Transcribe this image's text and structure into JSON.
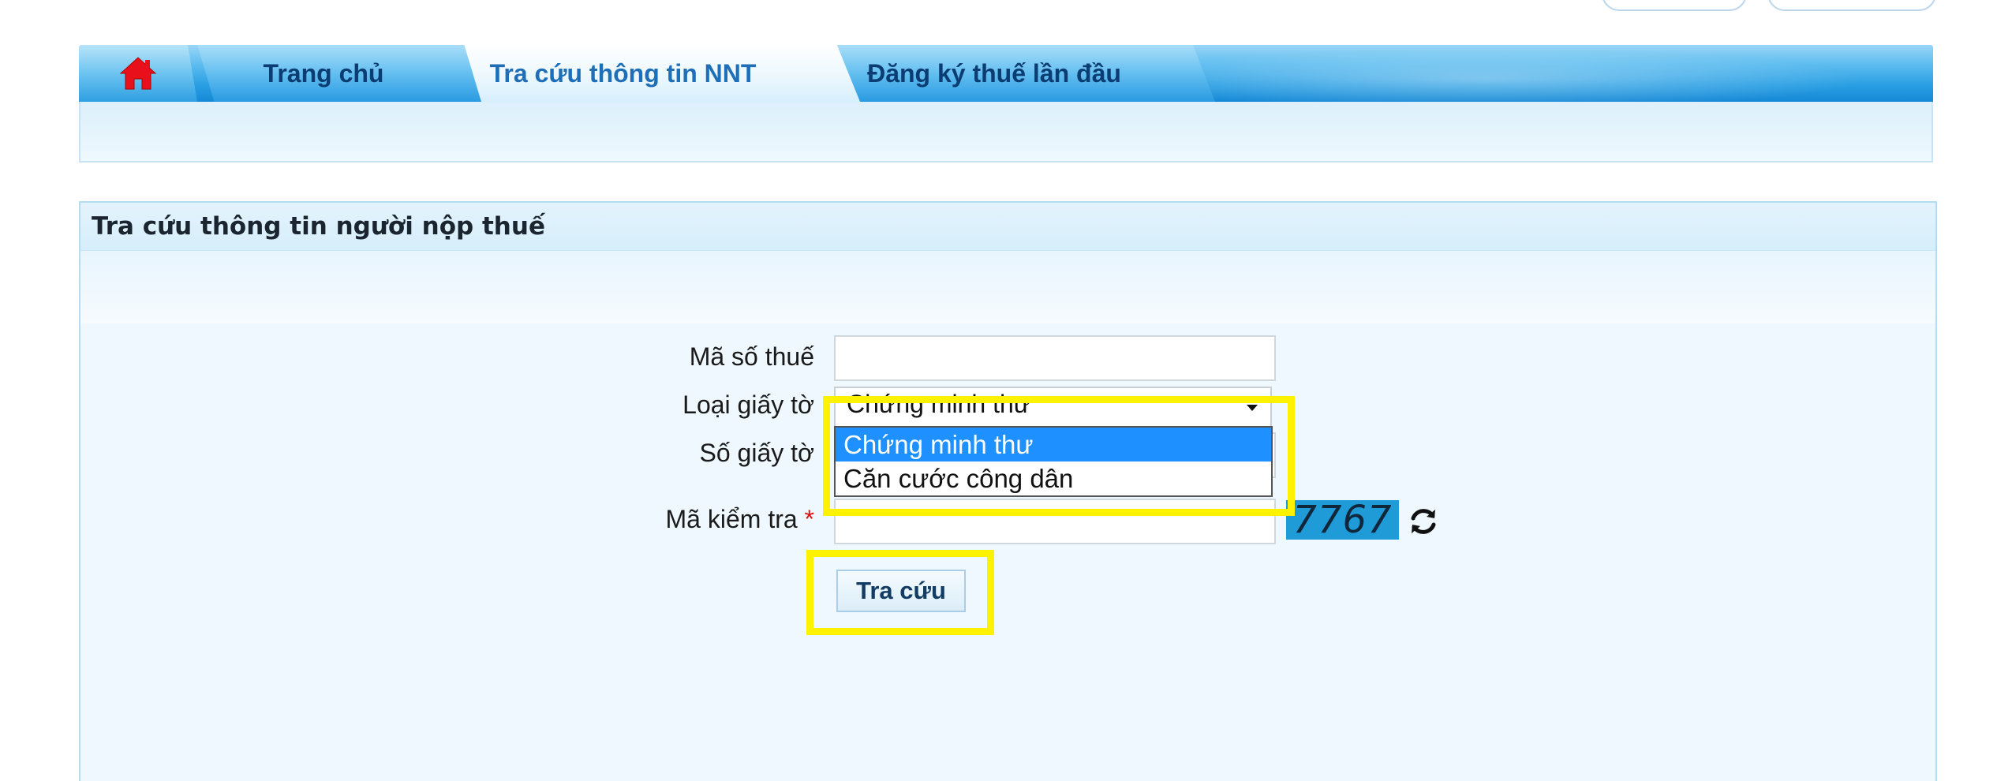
{
  "nav": {
    "tabs": [
      {
        "label": "Trang chủ"
      },
      {
        "label": "Tra cứu thông tin NNT"
      },
      {
        "label": "Đăng ký thuế lần đầu"
      }
    ]
  },
  "panel": {
    "title": "Tra cứu thông tin người nộp thuế"
  },
  "form": {
    "tax_code_label": "Mã số thuế",
    "tax_code_value": "",
    "doc_type_label": "Loại giấy tờ",
    "doc_type_selected": "Chứng minh thư",
    "doc_type_options": [
      "Chứng minh thư",
      "Căn cước công dân"
    ],
    "doc_number_label": "Số giấy tờ",
    "captcha_label": "Mã kiểm tra",
    "captcha_required_mark": "*",
    "captcha_value": "",
    "captcha_image_text": "7767",
    "submit_label": "Tra cứu"
  },
  "colors": {
    "nav_blue": "#2a9fe3",
    "highlight_yellow": "#fff200",
    "selected_option": "#1e90ff",
    "home_icon": "#e8101a"
  }
}
